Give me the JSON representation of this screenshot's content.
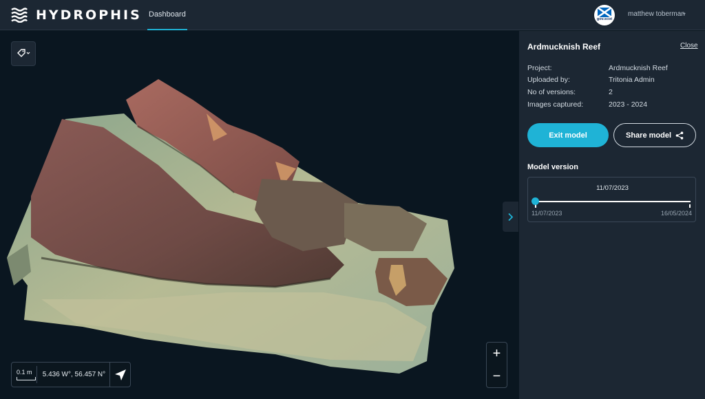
{
  "app": {
    "brand": "HYDROPHIS",
    "nav_tab": "Dashboard",
    "user_name": "matthew toberman",
    "org_badge": "gov.scot"
  },
  "viewer": {
    "scale_label": "0.1 m",
    "coordinates": "5.436 W°, 56.457 N°",
    "zoom_in": "+",
    "zoom_out": "−"
  },
  "panel": {
    "title": "Ardmucknish Reef",
    "close_label": "Close",
    "info": [
      {
        "label": "Project:",
        "value": "Ardmucknish Reef"
      },
      {
        "label": "Uploaded by:",
        "value": "Tritonia Admin"
      },
      {
        "label": "No of versions:",
        "value": "2"
      },
      {
        "label": "Images captured:",
        "value": "2023 - 2024"
      }
    ],
    "exit_button": "Exit model",
    "share_button": "Share model",
    "version_heading": "Model version",
    "version_current": "11/07/2023",
    "version_start": "11/07/2023",
    "version_end": "16/05/2024",
    "version_position": 0
  },
  "colors": {
    "accent": "#1fb3d6",
    "panel_bg": "#1c2733",
    "viewer_bg": "#0a1620"
  }
}
